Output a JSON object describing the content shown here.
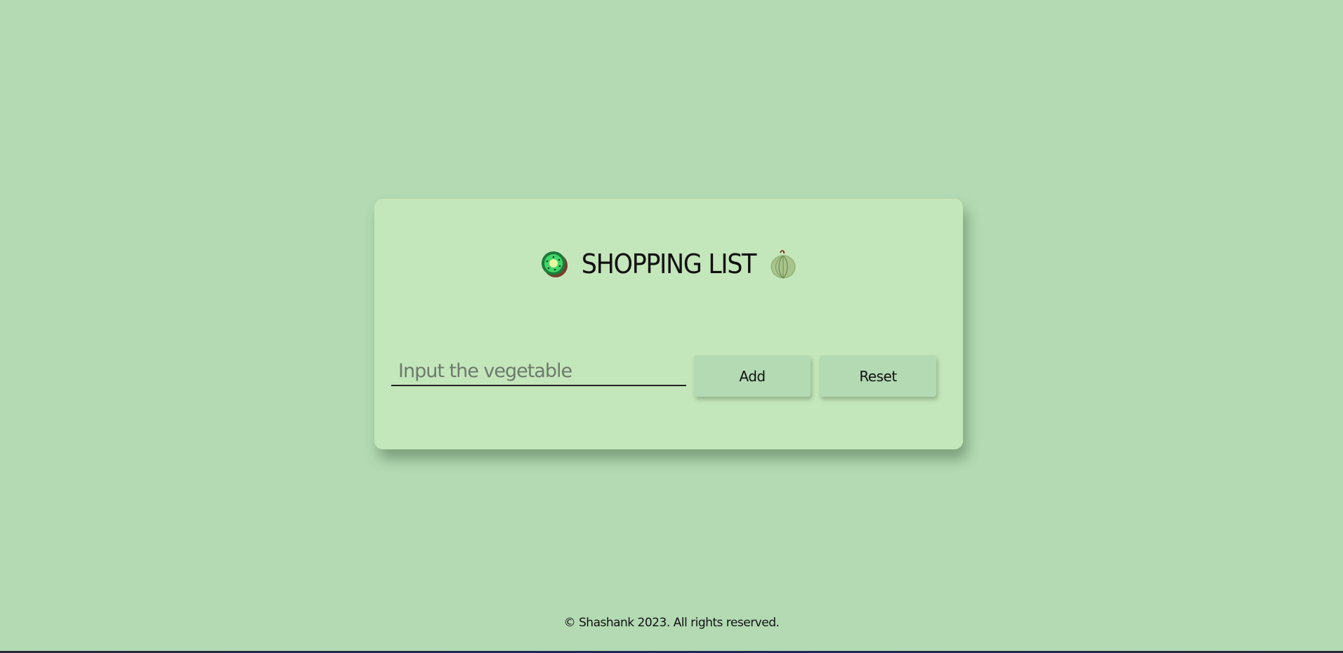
{
  "header": {
    "title": "SHOPPING LIST",
    "left_icon": "kiwi-icon",
    "right_icon": "melon-icon"
  },
  "form": {
    "input_placeholder": "Input the vegetable",
    "input_value": "",
    "add_label": "Add",
    "reset_label": "Reset"
  },
  "footer": {
    "text": "© Shashank 2023. All rights reserved."
  },
  "colors": {
    "background": "#b3dab3",
    "card": "#c4e6bb",
    "button": "#b3dab3",
    "text": "#111111"
  }
}
